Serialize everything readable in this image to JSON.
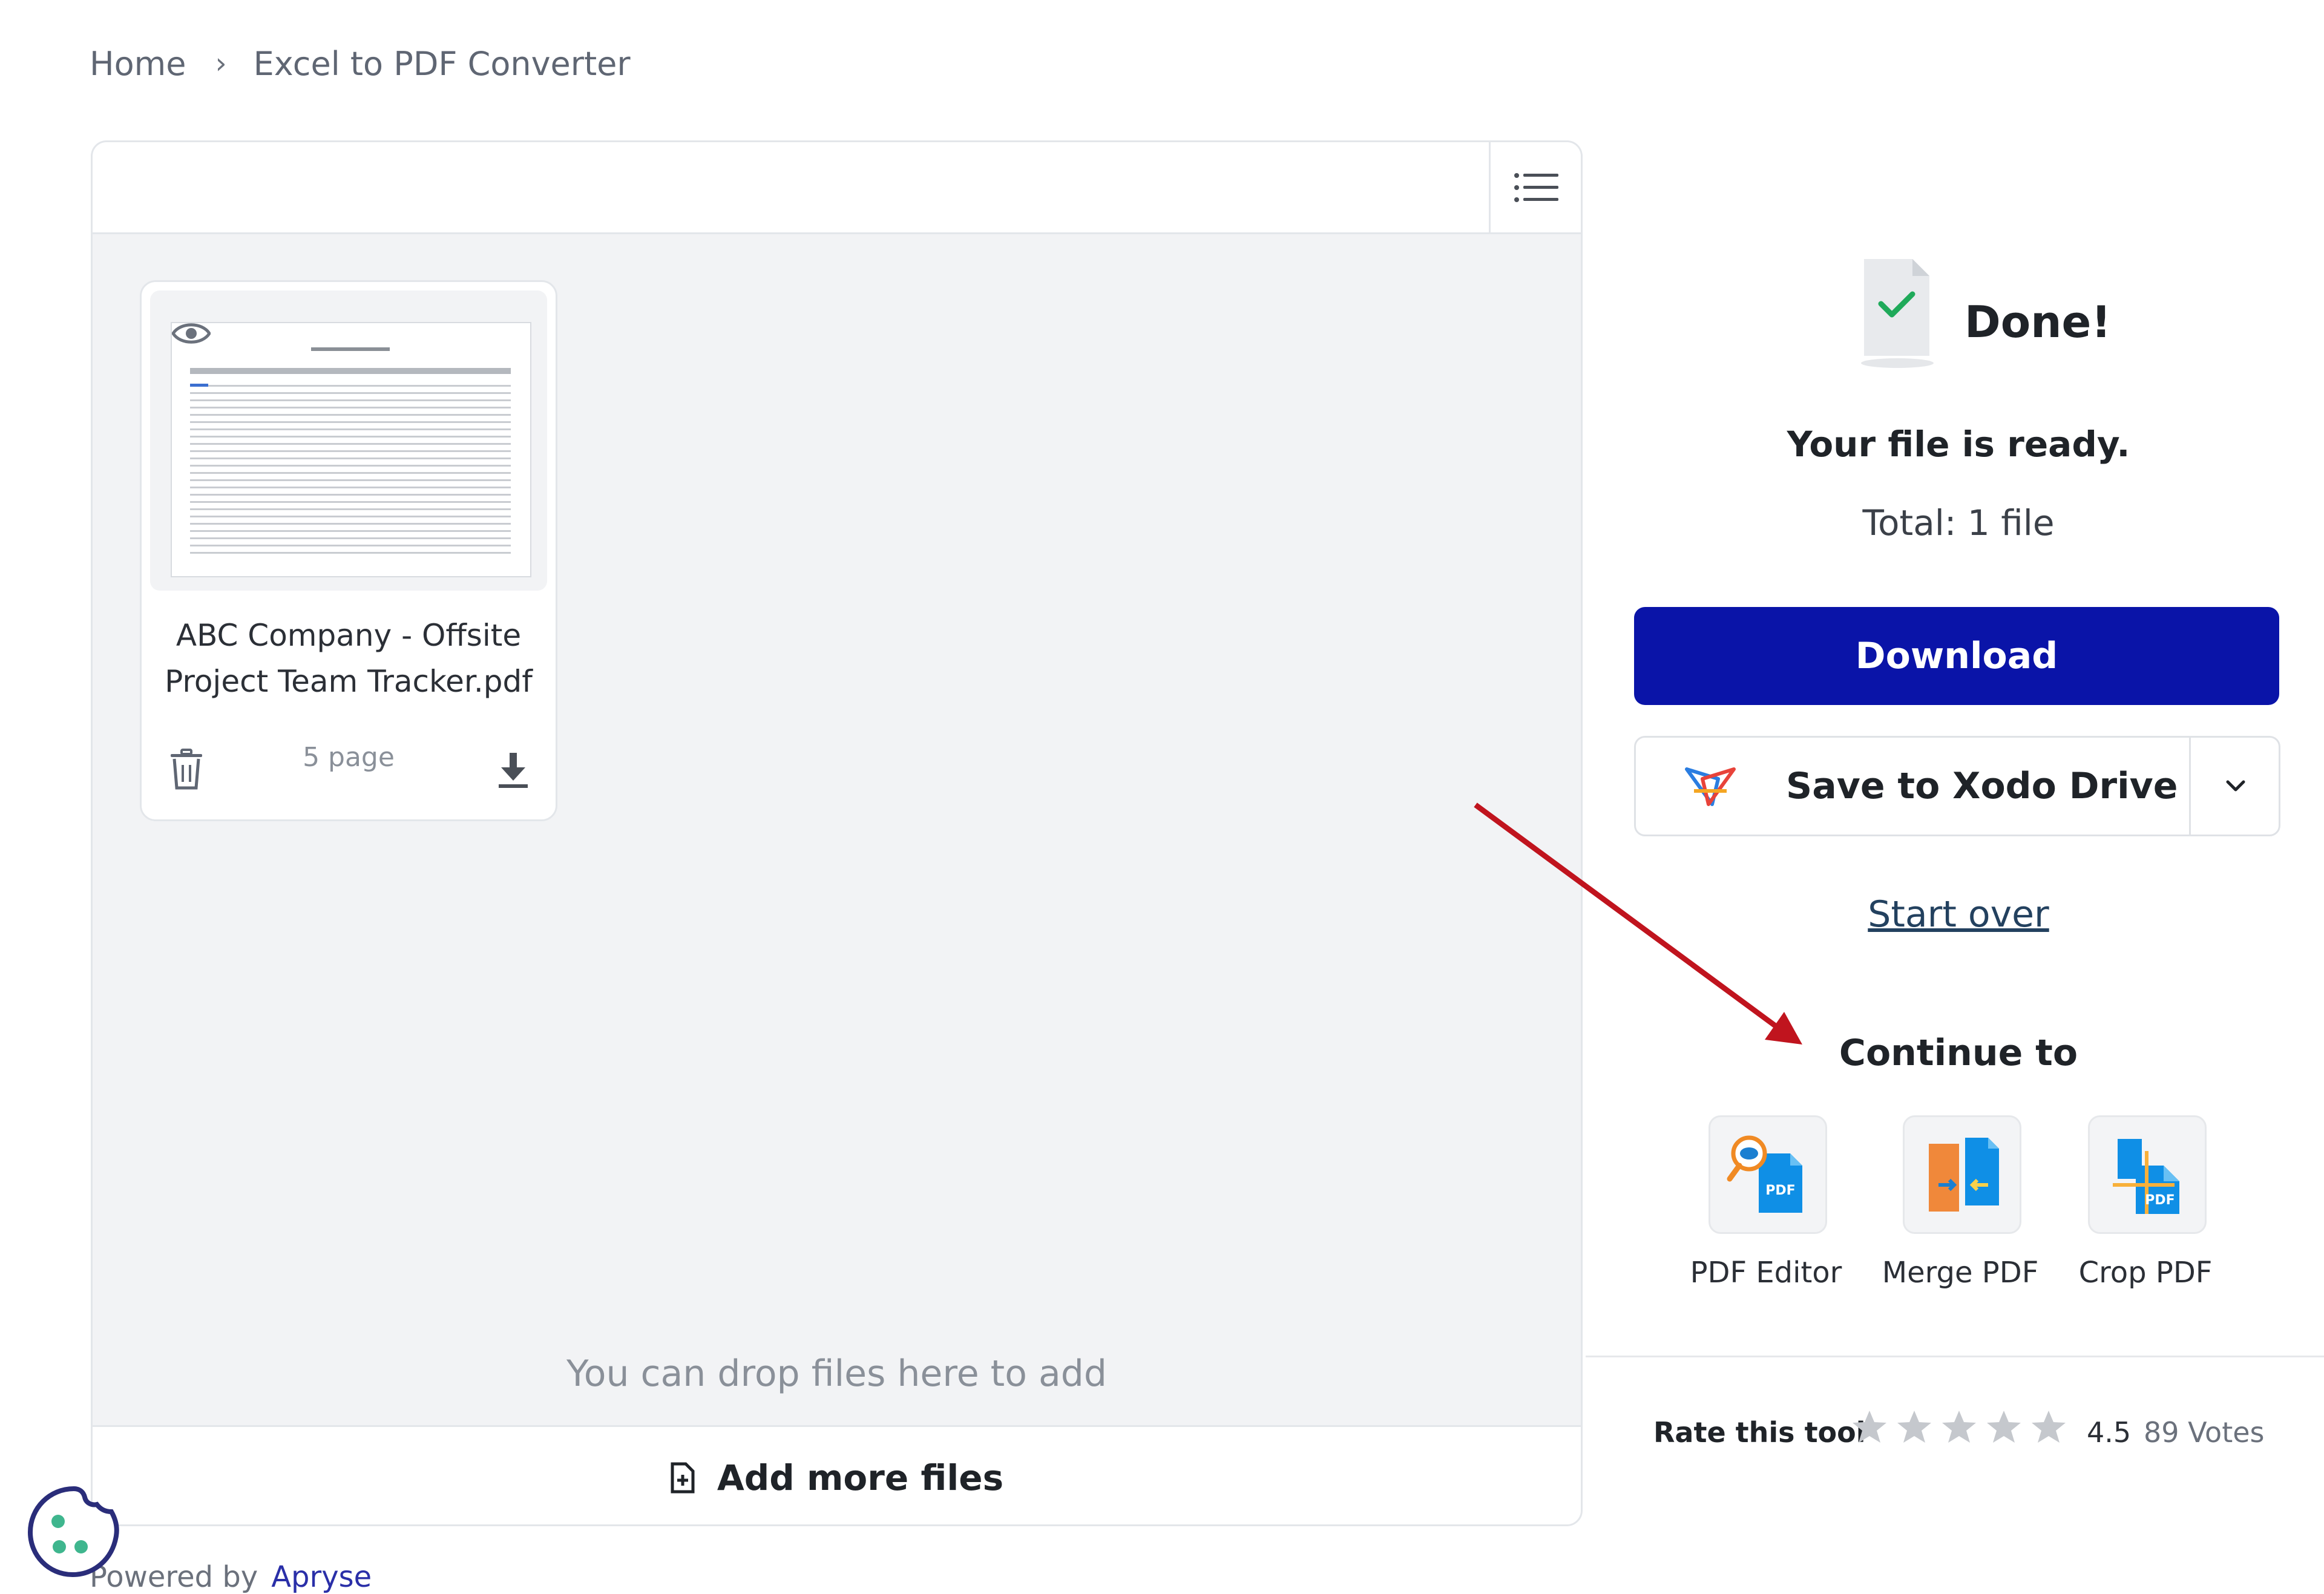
{
  "breadcrumb": {
    "home": "Home",
    "separator": "›",
    "current": "Excel to PDF Converter"
  },
  "files": [
    {
      "name": "ABC Company - Offsite Project Team Tracker.pdf",
      "pages": "5 page"
    }
  ],
  "drop_hint": "You can drop files here to add",
  "add_more_label": "Add more files",
  "result": {
    "title": "Done!",
    "ready": "Your file is ready.",
    "total": "Total: 1 file"
  },
  "actions": {
    "download": "Download",
    "save_xodo": "Save to Xodo Drive",
    "start_over": "Start over"
  },
  "continue": {
    "heading": "Continue to",
    "tools": [
      {
        "label": "PDF Editor",
        "icon": "pdf-editor-icon"
      },
      {
        "label": "Merge PDF",
        "icon": "merge-pdf-icon"
      },
      {
        "label": "Crop PDF",
        "icon": "crop-pdf-icon"
      }
    ]
  },
  "rating": {
    "label": "Rate this tool",
    "value": "4.5",
    "votes": "89 Votes",
    "stars_total": 5
  },
  "footer": {
    "powered_by": "Powered by",
    "brand": "Apryse"
  },
  "colors": {
    "primary": "#0a14a8",
    "link": "#23415f",
    "accent_arrow": "#c0141e",
    "brand": "#2a2fa8"
  }
}
